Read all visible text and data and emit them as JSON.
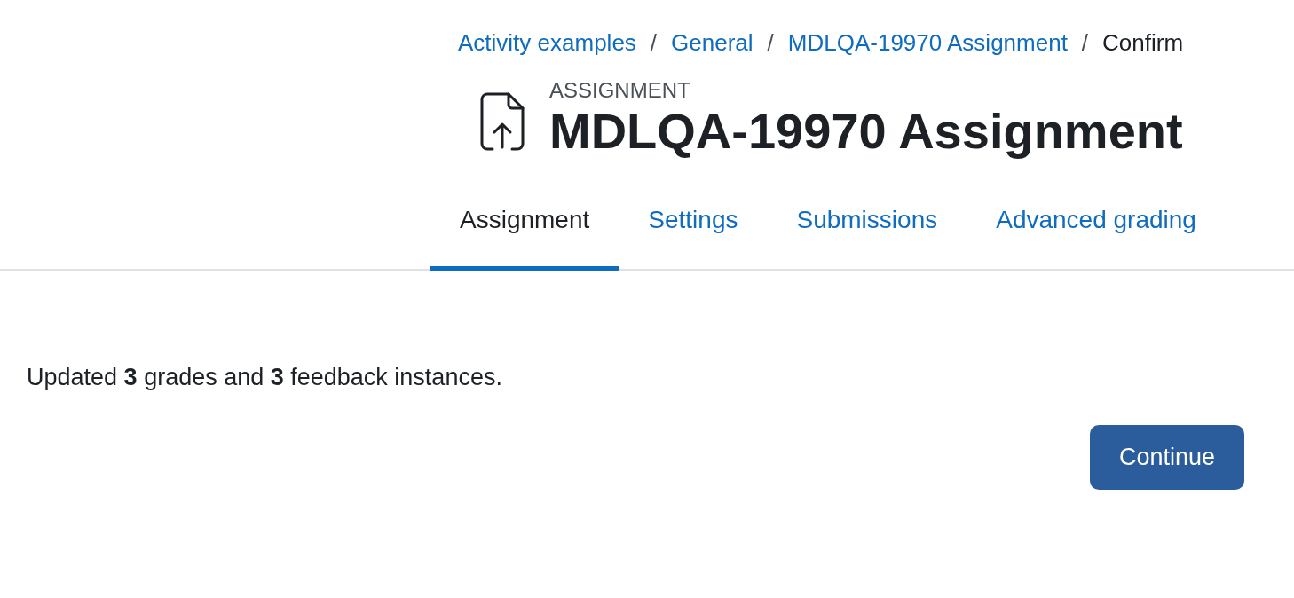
{
  "breadcrumb": [
    {
      "label": "Activity examples",
      "current": false
    },
    {
      "separator": "/",
      "label": "General",
      "current": false
    },
    {
      "separator": "/",
      "label": "MDLQA-19970 Assignment",
      "current": false
    },
    {
      "separator": "/",
      "label": "Confirm",
      "current": true
    }
  ],
  "header": {
    "pretitle": "ASSIGNMENT",
    "title": "MDLQA-19970 Assignment"
  },
  "tabs": [
    {
      "label": "Assignment",
      "selected": true
    },
    {
      "label": "Settings",
      "selected": false
    },
    {
      "label": "Submissions",
      "selected": false
    },
    {
      "label": "Advanced grading",
      "selected": false
    }
  ],
  "message": "Updated **3** grades and **3** feedback instances.",
  "button": "Continue"
}
